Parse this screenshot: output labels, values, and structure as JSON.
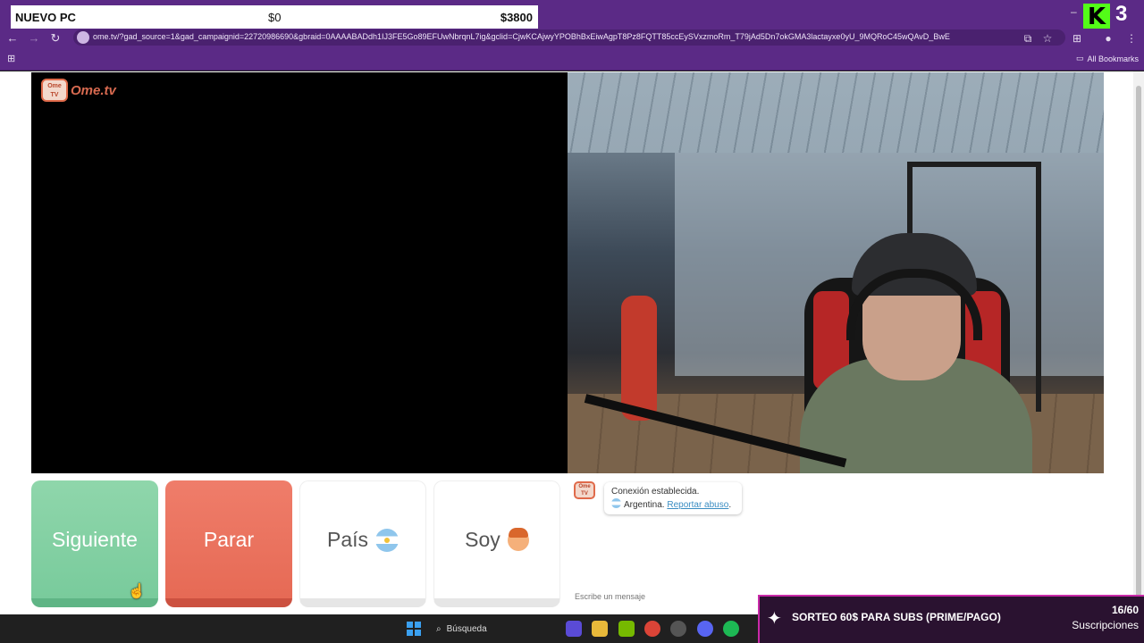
{
  "overlay_goal": {
    "title": "NUEVO PC",
    "start": "$0",
    "goal": "$3800"
  },
  "stream": {
    "number": "3",
    "kick_letter": "K"
  },
  "browser": {
    "url": "ome.tv/?gad_source=1&gad_campaignid=22720986690&gbraid=0AAAABADdh1IJ3FE5Go89EFUwNbrqnL7ig&gclid=CjwKCAjwyYPOBhBxEiwAgpT8Pz8FQTT85ccEySVxzmoRm_T79jAd5Dn7okGMA3lactayxe0yU_9MQRoC45wQAvD_BwE",
    "all_bookmarks": "All Bookmarks"
  },
  "omegle": {
    "logo_text": "Ome.tv",
    "logo_badge": "Ome TV",
    "buttons": {
      "next": "Siguiente",
      "stop": "Parar",
      "country": "País",
      "gender": "Soy"
    }
  },
  "chat": {
    "status": "Conexión establecida.",
    "country": "Argentina.",
    "report": "Reportar abuso",
    "input_placeholder": "Escribe un mensaje"
  },
  "taskbar": {
    "search_label": "Búsqueda"
  },
  "stream_overlay": {
    "giveaway": "SORTEO 60$ PARA SUBS (PRIME/PAGO)",
    "subs_count": "16/60",
    "subs_label": "Suscripciones"
  },
  "colors": {
    "next": "#79cb9c",
    "stop": "#e66a55",
    "kick": "#53fc18",
    "browser_chrome": "#5b2a86"
  }
}
